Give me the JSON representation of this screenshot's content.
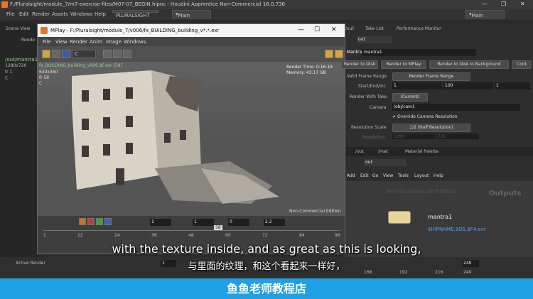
{
  "window": {
    "title": "F:/Pluralsight/module_7/m7-exercise-files/M07-07_BEGIN.hipnc - Houdini Apprentice Non-Commercial 16.0.736"
  },
  "menubar": {
    "items": [
      "File",
      "Edit",
      "Render",
      "Assets",
      "Windows",
      "Help"
    ],
    "desktop": "PLURALSIGHT",
    "workspace": "Main",
    "right_workspace": "Main"
  },
  "left": {
    "tab": "Scene View",
    "render": "Rende",
    "path": "/out/mantra1",
    "res": "1280x720",
    "fr": "fr 1",
    "c": "C"
  },
  "mplay": {
    "title": "MPlay - F:/Pluralsight/module_7/v006/fx_BUILDING_building_v*.*.exr",
    "menu": [
      "File",
      "View",
      "Render",
      "Anim",
      "Image",
      "Windows"
    ],
    "channel": "C",
    "file": "fx_BUILDING_building_v006.$F.exr [58]",
    "res": "640x360",
    "frame": "fr 58",
    "c": "C",
    "render_time": "Render Time: 0:16:19",
    "memory": "Memory:   43.17 GB",
    "watermark": "Non-Commercial Edition",
    "exposure": "1",
    "gamma_val": "1",
    "offset": "0",
    "gamma": "2.2",
    "cur_frame": "58",
    "ruler": [
      "1",
      "12",
      "24",
      "36",
      "48",
      "60",
      "72",
      "84",
      "96"
    ]
  },
  "right": {
    "tabs_top": [
      "/out",
      "Take List",
      "Performance Monitor"
    ],
    "path": "out",
    "node_type": "Mantra",
    "node_name": "mantra1",
    "buttons": [
      "Render to Disk",
      "Render to MPlay",
      "Render to Disk in Background",
      "Cont"
    ],
    "params": {
      "valid_frame_range": "Valid Frame Range",
      "frame_range": "Render Frame Range",
      "start_end": "Start/End/Inc",
      "start": "1",
      "end": "100",
      "inc": "1",
      "render_with_take": "Render With Take",
      "take": "(Current)",
      "camera_label": "Camera",
      "camera": "/obj/cam1",
      "override": "Override Camera Resolution",
      "res_scale": "Resolution Scale",
      "res_val": "1/2 (Half Resolution)",
      "resolution": "Resolution",
      "res_w": "1280",
      "res_h": "720"
    },
    "tabs_bottom": [
      "/out",
      "/mat",
      "Material Palette"
    ],
    "path2": "out",
    "menu2": [
      "Add",
      "Edit",
      "Go",
      "View",
      "Tools",
      "Layout",
      "Help"
    ],
    "nc": "Non-Commercial Edition",
    "outputs": "Outputs",
    "node": "mantra1",
    "node_path": "$HIPNAME.$OS.$F4.exr"
  },
  "bottom": {
    "tab": "Active Render",
    "frame": "1",
    "ruler": [
      "168",
      "192",
      "216",
      "240"
    ],
    "end_field": "240"
  },
  "subtitles": {
    "en": "with the texture inside, and as great as this is looking,",
    "zh": "与里面的纹理，和这个看起来一样好，"
  },
  "banner": "鱼鱼老师教程店"
}
